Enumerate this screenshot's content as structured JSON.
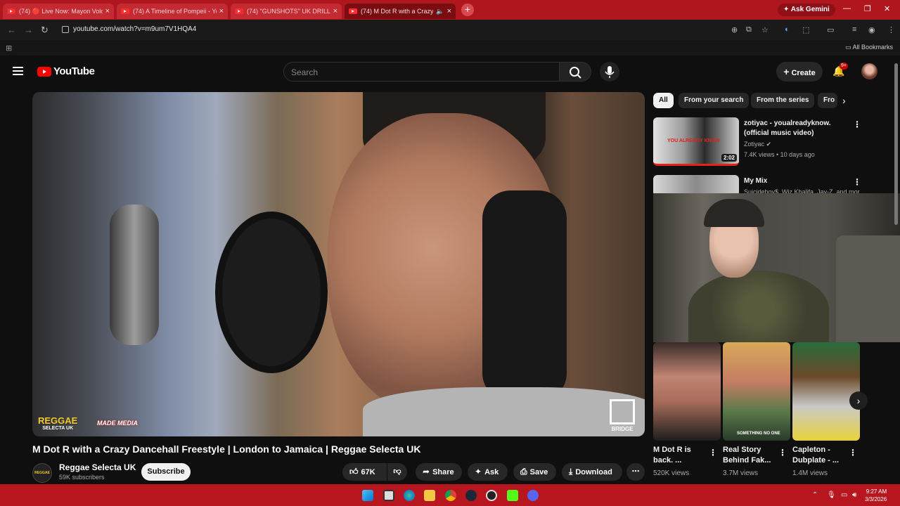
{
  "browser": {
    "tabs": [
      {
        "title": "(74) 🔴 Live Now: Mayon Volc..."
      },
      {
        "title": "(74) A Timeline of Pompeii - Yo..."
      },
      {
        "title": "(74) \"GUNSHOTS\" UK DRILL Fr..."
      },
      {
        "title": "(74) M Dot R with a Crazy D..."
      }
    ],
    "new_tab": "+",
    "gemini": "✦ Ask Gemini",
    "url": "youtube.com/watch?v=m9um7V1HQA4",
    "all_bookmarks": "All Bookmarks"
  },
  "youtube": {
    "logo_text": "YouTube",
    "search_placeholder": "Search",
    "create_label": "Create",
    "notifications_badge": "9+"
  },
  "video": {
    "title": "M Dot R with a Crazy Dancehall Freestyle | London to Jamaica | Reggae Selecta UK",
    "channel": "Reggae Selecta UK",
    "subscribers": "59K subscribers",
    "subscribe_label": "Subscribe",
    "likes": "67K",
    "share_label": "Share",
    "ask_label": "Ask",
    "save_label": "Save",
    "download_label": "Download",
    "watermark_left": "REGGAE",
    "watermark_left_sub": "SELECTA UK",
    "watermark_mid": "MADE MEDIA",
    "watermark_right": "BRIDGE",
    "channel_avatar_text": "REGGAE SELECTA"
  },
  "chips": [
    "All",
    "From your search",
    "From the series",
    "Fro"
  ],
  "recommendations": [
    {
      "title": "zotiyac - youalreadyknow. (official music video)",
      "channel": "Zotiyac",
      "meta": "7.4K views • 10 days ago",
      "duration": "2:02",
      "thumb_text": "YOU ALREADY KNOW"
    },
    {
      "title": "My Mix",
      "channel": "Suicideboy$, Wiz Khalifa, Jay-Z, and more"
    }
  ],
  "shorts": [
    {
      "title": "M Dot R is back. ...",
      "views": "520K views"
    },
    {
      "title": "Real Story Behind Fak...",
      "views": "3.7M views",
      "thumb_text": "SOMETHING NO ONE"
    },
    {
      "title": "Capleton - Dubplate - ...",
      "views": "1.4M views"
    }
  ],
  "taskbar": {
    "time": "9:27 AM",
    "date": "3/3/2026"
  }
}
